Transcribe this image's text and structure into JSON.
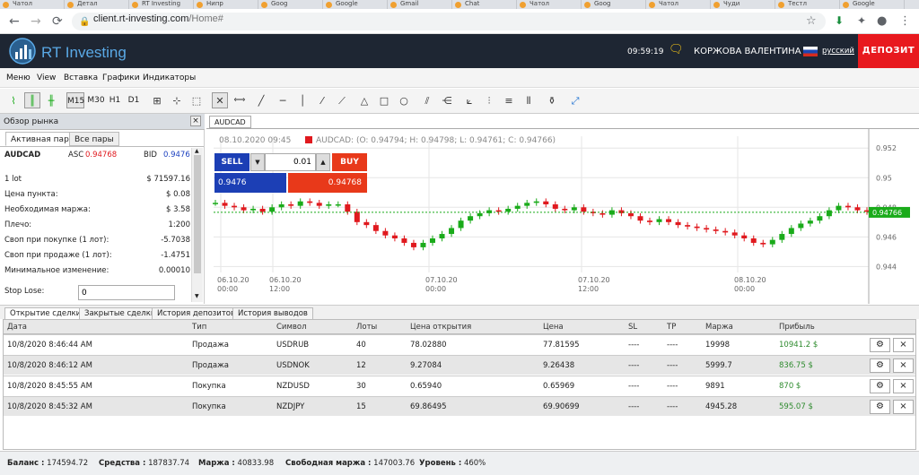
{
  "browser": {
    "tabs": [
      "Чатол",
      "Детал",
      "RT Investing",
      "Нипр",
      "Goog",
      "Google",
      "Gmail",
      "Chat",
      "Чатол",
      "Goog",
      "Чатол",
      "Чуди",
      "Тестл",
      "Google"
    ],
    "url_host": "client.rt-investing.com",
    "url_path": "/Home#"
  },
  "header": {
    "logo": "RT Investing",
    "time": "09:59:19",
    "user": "КОРЖОВА ВАЛЕНТИНА",
    "language": "русский",
    "deposit": "ДЕПОЗИТ"
  },
  "menu": [
    "Меню",
    "View",
    "Вставка",
    "Графики",
    "Индикаторы"
  ],
  "timeframes": [
    "M15",
    "M30",
    "H1",
    "D1"
  ],
  "sidebar": {
    "title": "Обзор рынка",
    "close": "×",
    "tabs": [
      "Активная пара",
      "Все пары"
    ],
    "pair": "AUDCAD",
    "ask_label": "ASC",
    "ask": "0.94768",
    "bid_label": "BID",
    "bid": "0.9476",
    "rows": [
      {
        "label": "1 lot",
        "value": "$ 71597.16"
      },
      {
        "label": "Цена пункта:",
        "value": "$ 0.08"
      },
      {
        "label": "Необходимая маржа:",
        "value": "$ 3.58"
      },
      {
        "label": "Плечо:",
        "value": "1:200"
      },
      {
        "label": "Своп при покупке (1 лот):",
        "value": "-5.7038"
      },
      {
        "label": "Своп при продаже (1 лот):",
        "value": "-1.4751"
      },
      {
        "label": "Минимальное изменение:",
        "value": "0.00010"
      }
    ],
    "stop_loss_label": "Stop Lose:",
    "stop_loss_value": "0"
  },
  "chart": {
    "tab": "AUDCAD",
    "info_date": "08.10.2020 09:45",
    "info_ohlc": "AUDCAD: (O: 0.94794; H: 0.94798; L: 0.94761; C: 0.94766)",
    "sell_label": "SELL",
    "buy_label": "BUY",
    "lot": "0.01",
    "sell_price": "0.9476",
    "buy_price": "0.94768",
    "current_price": "0.94766",
    "y_ticks": [
      "0.952",
      "0.95",
      "0.948",
      "0.946",
      "0.944"
    ],
    "x_ticks": [
      {
        "date": "06.10.20",
        "time": "00:00"
      },
      {
        "date": "06.10.20",
        "time": "12:00"
      },
      {
        "date": "07.10.20",
        "time": "00:00"
      },
      {
        "date": "07.10.20",
        "time": "12:00"
      },
      {
        "date": "08.10.20",
        "time": "00:00"
      }
    ],
    "up_color": "#1aab1a",
    "down_color": "#e0191e"
  },
  "chart_data": {
    "type": "line",
    "title": "",
    "series": [
      {
        "name": "AUDCAD",
        "values": [
          0.9483,
          0.9481,
          0.948,
          0.9478,
          0.9479,
          0.9477,
          0.948,
          0.9482,
          0.9481,
          0.9484,
          0.9483,
          0.9481,
          0.9482,
          0.9482,
          0.9477,
          0.947,
          0.9468,
          0.9464,
          0.9461,
          0.9459,
          0.9456,
          0.9453,
          0.9456,
          0.9459,
          0.9462,
          0.9466,
          0.9471,
          0.9474,
          0.9476,
          0.9478,
          0.9477,
          0.9479,
          0.9481,
          0.9483,
          0.9484,
          0.9482,
          0.9479,
          0.9478,
          0.948,
          0.9477,
          0.9476,
          0.9475,
          0.9478,
          0.9476,
          0.9474,
          0.9471,
          0.947,
          0.9472,
          0.947,
          0.9468,
          0.9467,
          0.9466,
          0.9465,
          0.9464,
          0.9463,
          0.9461,
          0.9459,
          0.9456,
          0.9455,
          0.9458,
          0.9462,
          0.9466,
          0.9469,
          0.9471,
          0.9474,
          0.9478,
          0.9481,
          0.948,
          0.9478,
          0.9477
        ]
      }
    ],
    "ylim": [
      0.9436,
      0.9528
    ],
    "current": 0.94766
  },
  "trades": {
    "tabs": [
      "Открытие сделки",
      "Закрытые сделки",
      "История депозитов",
      "История выводов"
    ],
    "columns": [
      "Дата",
      "Тип",
      "Символ",
      "Лоты",
      "Цена открытия",
      "Цена",
      "SL",
      "TP",
      "Маржа",
      "Прибыль"
    ],
    "rows": [
      {
        "date": "10/8/2020 8:46:44 AM",
        "type": "Продажа",
        "symbol": "USDRUB",
        "lots": "40",
        "open": "78.02880",
        "price": "77.81595",
        "sl": "----",
        "tp": "----",
        "margin": "19998",
        "profit": "10941.2 $"
      },
      {
        "date": "10/8/2020 8:46:12 AM",
        "type": "Продажа",
        "symbol": "USDNOK",
        "lots": "12",
        "open": "9.27084",
        "price": "9.26438",
        "sl": "----",
        "tp": "----",
        "margin": "5999.7",
        "profit": "836.75 $"
      },
      {
        "date": "10/8/2020 8:45:55 AM",
        "type": "Покупка",
        "symbol": "NZDUSD",
        "lots": "30",
        "open": "0.65940",
        "price": "0.65969",
        "sl": "----",
        "tp": "----",
        "margin": "9891",
        "profit": "870 $"
      },
      {
        "date": "10/8/2020 8:45:32 AM",
        "type": "Покупка",
        "symbol": "NZDJPY",
        "lots": "15",
        "open": "69.86495",
        "price": "69.90699",
        "sl": "----",
        "tp": "----",
        "margin": "4945.28",
        "profit": "595.07 $"
      }
    ],
    "profit_color": "#2e8b2e"
  },
  "status": [
    {
      "label": "Баланс :",
      "value": "174594.72"
    },
    {
      "label": "Средства :",
      "value": "187837.74"
    },
    {
      "label": "Маржа :",
      "value": "40833.98"
    },
    {
      "label": "Свободная маржа :",
      "value": "147003.76"
    },
    {
      "label": "Уровень :",
      "value": "460%"
    }
  ]
}
